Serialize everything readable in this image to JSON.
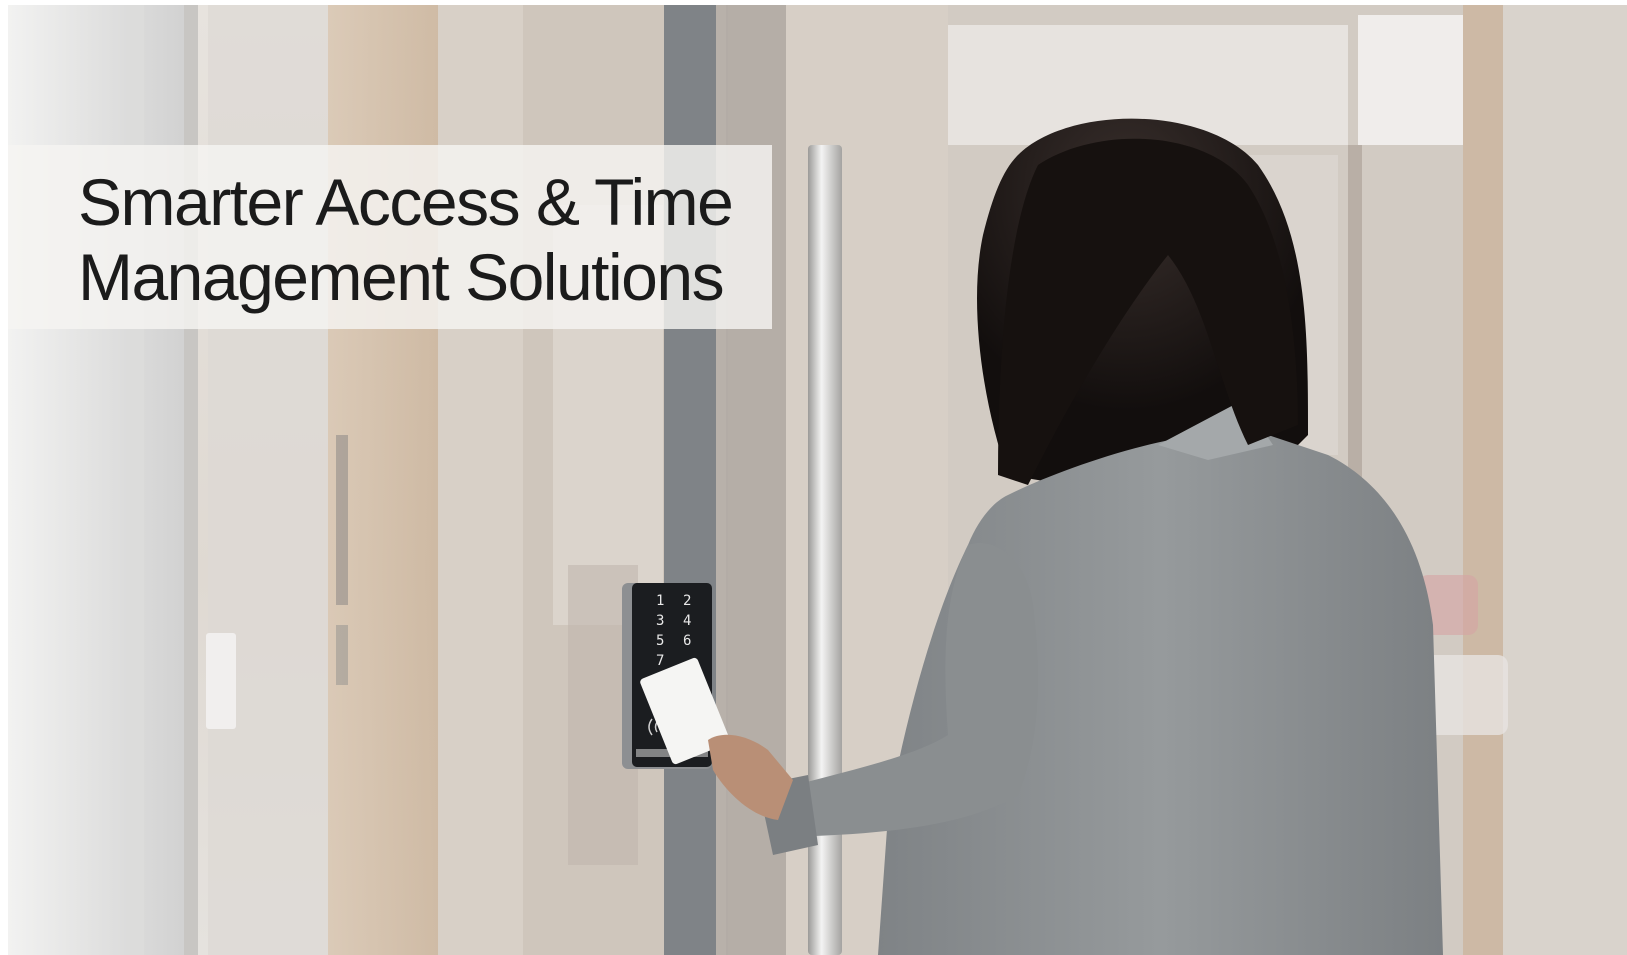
{
  "hero": {
    "headline_line1": "Smarter Access & Time",
    "headline_line2": "Management Solutions"
  },
  "keypad": {
    "keys": [
      "1",
      "2",
      "3",
      "4",
      "5",
      "6",
      "7"
    ]
  },
  "colors": {
    "headline_text": "#1b1b1b",
    "band": "#f5f4f2",
    "jacket": "#8e9193",
    "hair": "#1a1514",
    "reader": "#1b1d20"
  }
}
